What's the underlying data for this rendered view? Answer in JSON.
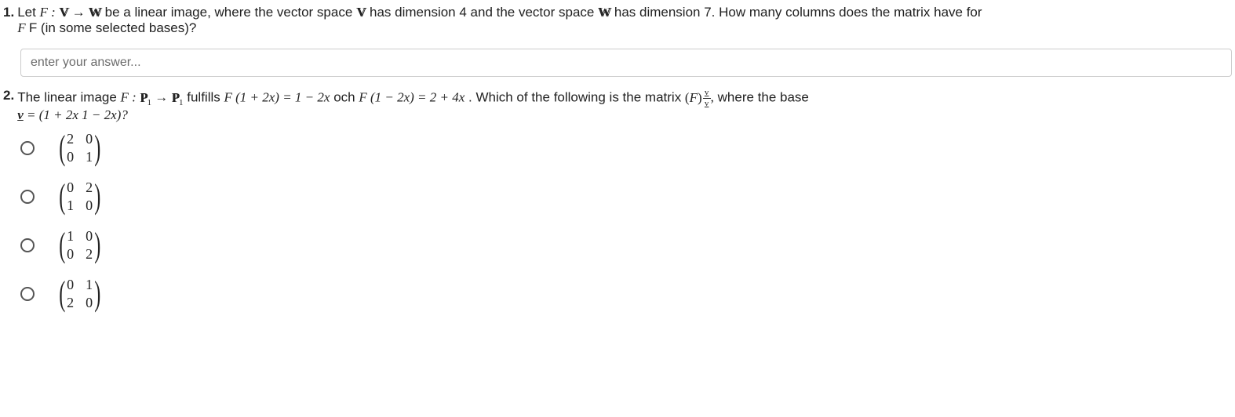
{
  "q1": {
    "number": "1.",
    "text_parts": {
      "a": "Let ",
      "map": "F : ",
      "arrow": " → ",
      "b": " be a linear image, where the vector space ",
      "c": " has dimension 4 and the vector space ",
      "d": " has dimension 7. How many columns does the matrix have for",
      "line2": "F (in some selected bases)?"
    },
    "placeholder": "enter your answer..."
  },
  "q2": {
    "number": "2.",
    "text_parts": {
      "a": "The linear image  ",
      "map_left": "F : ",
      "p1": "P",
      "sub": "1",
      "arrow": " → ",
      "b": " fulfills  ",
      "eq1": "F (1 + 2x) = 1 − 2x",
      "och": " och ",
      "eq2": "F (1 − 2x) = 2 + 4x",
      "c": ". Which of the following is the matrix ",
      "fparen_l": "(",
      "fF": "F",
      "fparen_r": ")",
      "comma": ",",
      "d": "  where the base",
      "line2a": "v",
      "line2b": " = (1 + 2x  1 − 2x)?"
    },
    "vlabel": "v",
    "options": [
      {
        "cells": [
          "2",
          "0",
          "0",
          "1"
        ]
      },
      {
        "cells": [
          "0",
          "2",
          "1",
          "0"
        ]
      },
      {
        "cells": [
          "1",
          "0",
          "0",
          "2"
        ]
      },
      {
        "cells": [
          "0",
          "1",
          "2",
          "0"
        ]
      }
    ]
  }
}
